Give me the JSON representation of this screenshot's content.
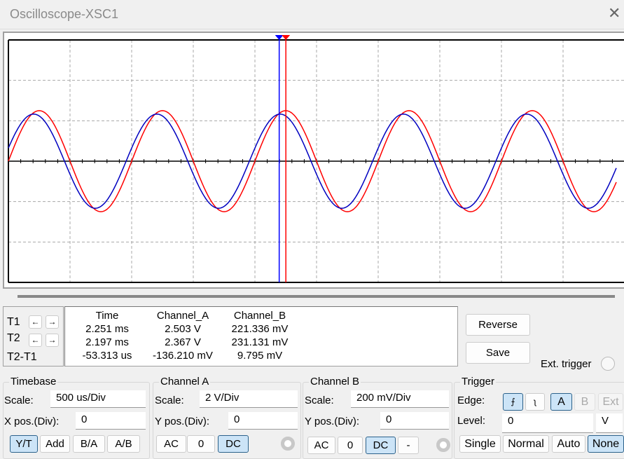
{
  "window": {
    "title": "Oscilloscope-XSC1",
    "close_icon": "close-icon"
  },
  "colors": {
    "channel_a": "#ff0000",
    "channel_b": "#0000c0",
    "cursor_t1": "#ff0000",
    "cursor_t2": "#0000ff",
    "active_button": "#cce4f7"
  },
  "chart_data": {
    "type": "line",
    "x_unit": "ms",
    "x_range": [
      0,
      5
    ],
    "x_divisions": 10,
    "y_divisions": 6,
    "grid": true,
    "series": [
      {
        "name": "Channel_A",
        "waveform": "sine",
        "amplitude_V": 2.5,
        "frequency_Hz": 1000,
        "phase_deg": 0,
        "scale_V_per_div": 2
      },
      {
        "name": "Channel_B",
        "waveform": "sine",
        "amplitude_V": 0.233,
        "frequency_Hz": 1000,
        "phase_lead_us": 45,
        "scale_V_per_div": 0.2
      }
    ],
    "cursors": {
      "T1_ms": 2.251,
      "T2_ms": 2.197
    }
  },
  "cursors": {
    "t1_label": "T1",
    "t2_label": "T2",
    "diff_label": "T2-T1",
    "headers": [
      "Time",
      "Channel_A",
      "Channel_B"
    ],
    "rows": [
      [
        "2.251 ms",
        "2.503 V",
        "221.336 mV"
      ],
      [
        "2.197 ms",
        "2.367 V",
        "231.131 mV"
      ],
      [
        "-53.313 us",
        "-136.210 mV",
        "9.795 mV"
      ]
    ],
    "left_arrow": "←",
    "right_arrow": "→"
  },
  "buttons": {
    "reverse": "Reverse",
    "save": "Save",
    "ext_trigger": "Ext. trigger"
  },
  "timebase": {
    "title": "Timebase",
    "scale_label": "Scale:",
    "scale": "500 us/Div",
    "xpos_label": "X pos.(Div):",
    "xpos": "0",
    "modes": [
      "Y/T",
      "Add",
      "B/A",
      "A/B"
    ],
    "active_mode": "Y/T"
  },
  "channel_a": {
    "title": "Channel A",
    "scale_label": "Scale:",
    "scale": "2  V/Div",
    "ypos_label": "Y pos.(Div):",
    "ypos": "0",
    "coupling": [
      "AC",
      "0",
      "DC"
    ],
    "active": "DC"
  },
  "channel_b": {
    "title": "Channel B",
    "scale_label": "Scale:",
    "scale": "200 mV/Div",
    "ypos_label": "Y pos.(Div):",
    "ypos": "0",
    "coupling": [
      "AC",
      "0",
      "DC",
      "-"
    ],
    "active": "DC"
  },
  "trigger": {
    "title": "Trigger",
    "edge_label": "Edge:",
    "edge_rising": "⨍",
    "edge_falling": "ʅ",
    "sources": [
      "A",
      "B",
      "Ext"
    ],
    "active_source": "A",
    "level_label": "Level:",
    "level": "0",
    "level_unit": "V",
    "modes": [
      "Single",
      "Normal",
      "Auto",
      "None"
    ],
    "active_mode": "None"
  }
}
